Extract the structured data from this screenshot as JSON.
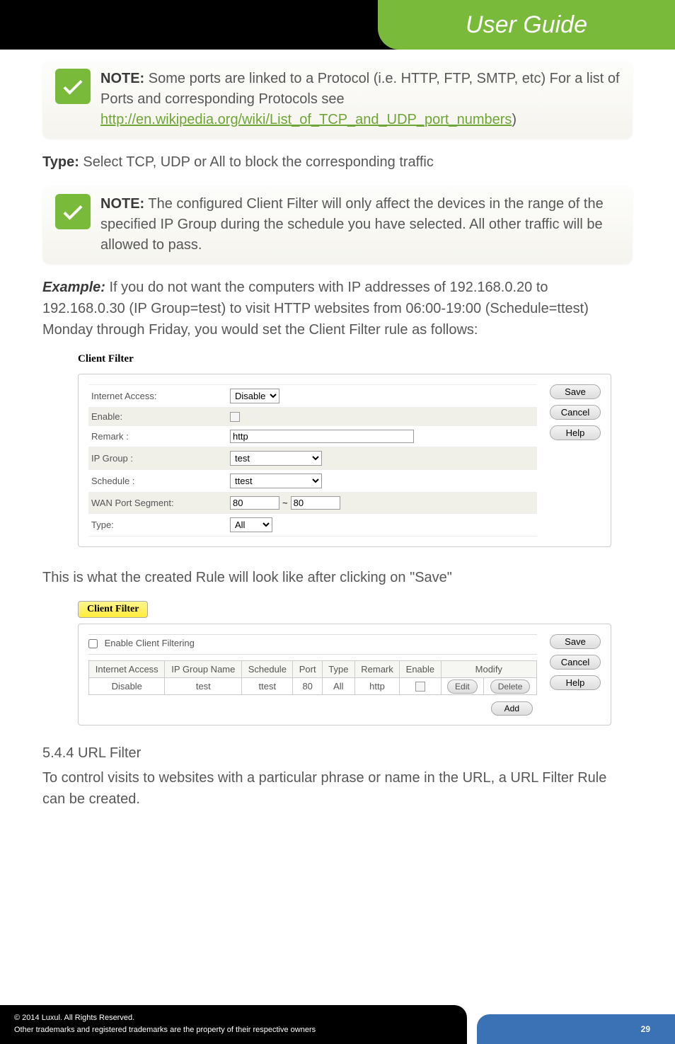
{
  "header": {
    "title": "User Guide"
  },
  "note1": {
    "label": "NOTE:",
    "text": " Some ports are linked to a Protocol (i.e. HTTP, FTP, SMTP, etc) For a list of Ports and corresponding Protocols see ",
    "link": "http://en.wikipedia.org/wiki/List_of_TCP_and_UDP_port_numbers",
    "after": ")"
  },
  "type_line": {
    "label": "Type:",
    "text": " Select TCP, UDP or All to block the corresponding traffic"
  },
  "note2": {
    "label": "NOTE:",
    "text": " The configured Client Filter will only affect the devices in the range of the specified IP Group during the schedule you have selected. All other traffic will be allowed to pass."
  },
  "example": {
    "label": "Example:",
    "text": " If you do not want the computers with IP addresses of 192.168.0.20 to 192.168.0.30 (IP Group=test) to visit HTTP websites from 06:00-19:00 (Schedule=ttest) Monday through Friday, you would set the Client Filter rule as follows:"
  },
  "screenshot1": {
    "title": "Client Filter",
    "rows": {
      "internet_access": {
        "label": "Internet Access:",
        "value": "Disable"
      },
      "enable": {
        "label": "Enable:"
      },
      "remark": {
        "label": "Remark :",
        "value": "http"
      },
      "ip_group": {
        "label": "IP Group :",
        "value": "test"
      },
      "schedule": {
        "label": "Schedule :",
        "value": "ttest"
      },
      "wan_port": {
        "label": "WAN Port Segment:",
        "from": "80",
        "to": "80",
        "tilde": "~"
      },
      "type": {
        "label": "Type:",
        "value": "All"
      }
    },
    "buttons": {
      "save": "Save",
      "cancel": "Cancel",
      "help": "Help"
    }
  },
  "after_save_text": "This is what the created Rule will look like after clicking on \"Save\"",
  "screenshot2": {
    "tab": "Client Filter",
    "enable_label": "Enable Client Filtering",
    "headers": [
      "Internet Access",
      "IP Group Name",
      "Schedule",
      "Port",
      "Type",
      "Remark",
      "Enable",
      "Modify"
    ],
    "row": {
      "internet_access": "Disable",
      "ip_group": "test",
      "schedule": "ttest",
      "port": "80",
      "type": "All",
      "remark": "http",
      "edit": "Edit",
      "delete": "Delete"
    },
    "buttons": {
      "save": "Save",
      "cancel": "Cancel",
      "help": "Help",
      "add": "Add"
    }
  },
  "section": {
    "heading": "5.4.4 URL Filter",
    "text": "To control visits to websites with a particular phrase or name in the URL, a URL Filter Rule can be created."
  },
  "footer": {
    "copyright": "© 2014  Luxul. All Rights Reserved.",
    "trademark": "Other trademarks and registered trademarks are the property of their respective owners",
    "page": "29"
  }
}
